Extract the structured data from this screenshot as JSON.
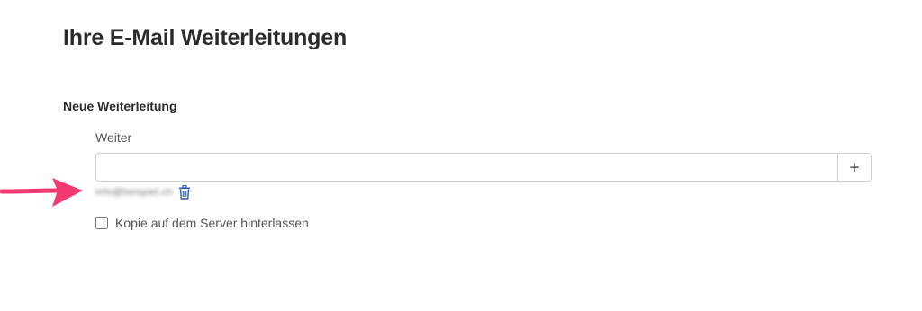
{
  "page": {
    "title": "Ihre E-Mail Weiterleitungen"
  },
  "new_forward": {
    "section_title": "Neue Weiterleitung",
    "field_label": "Weiter",
    "input_value": "",
    "add_button_label": "+"
  },
  "forward_list": [
    {
      "address": "info@beispiel.ch"
    }
  ],
  "copy_option": {
    "label": "Kopie auf dem Server hinterlassen",
    "checked": false
  },
  "colors": {
    "annotation_arrow": "#f23a72",
    "trash_icon": "#2f5fb3"
  }
}
